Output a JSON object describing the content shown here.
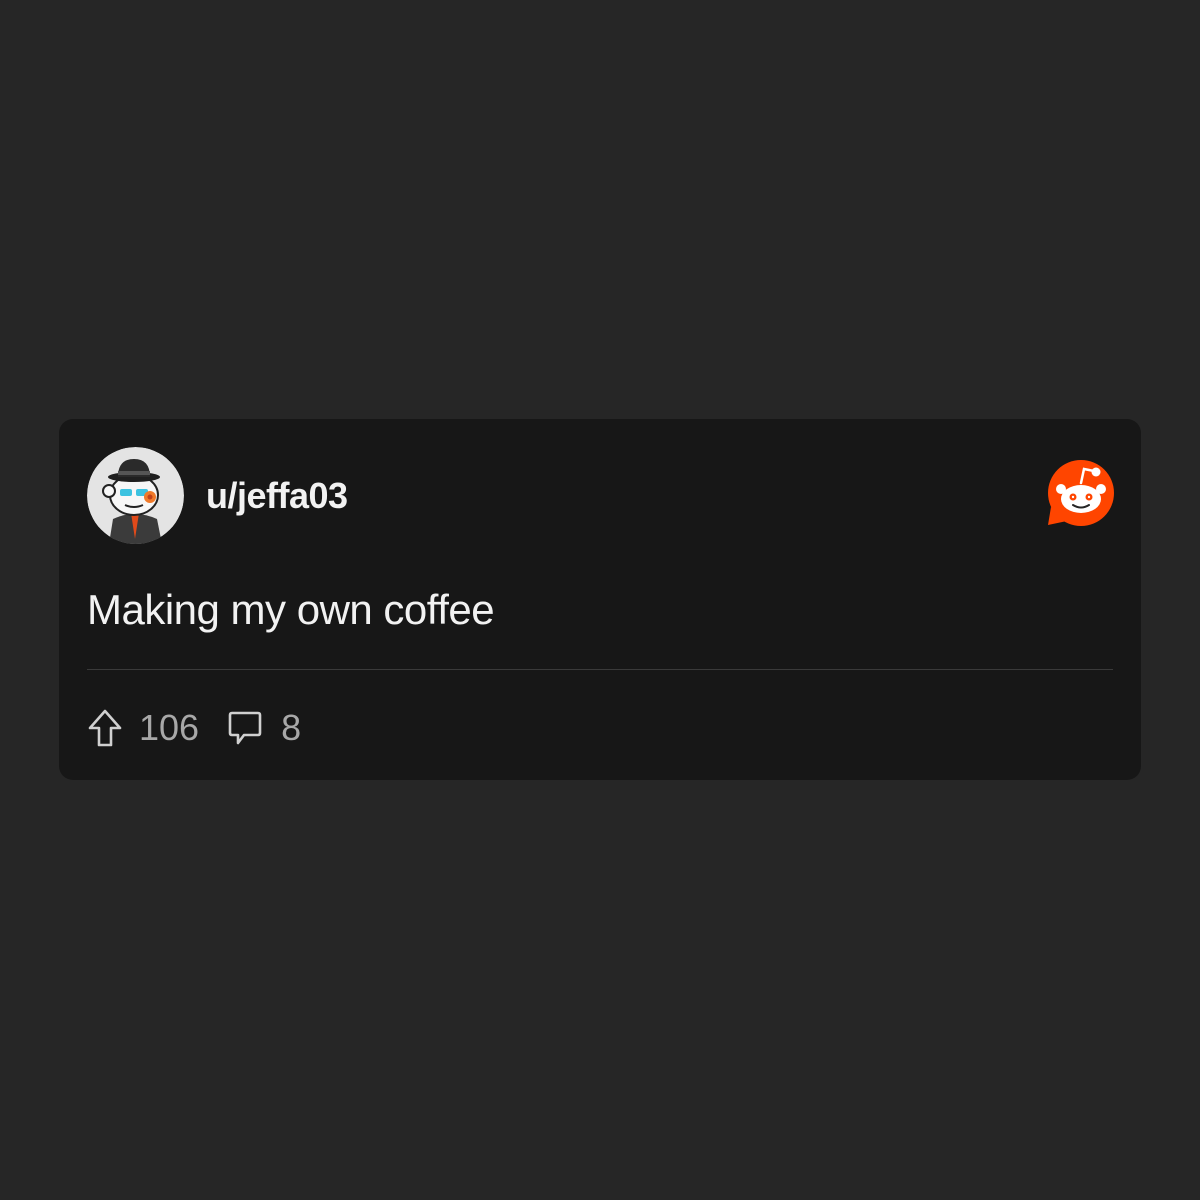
{
  "post": {
    "username": "u/jeffa03",
    "text": "Making my own coffee",
    "upvotes": "106",
    "comments": "8"
  },
  "icons": {
    "avatar": "snoo-avatar-bowler-hat",
    "brand": "reddit-logo",
    "upvote": "upvote-arrow-icon",
    "comment": "speech-bubble-icon"
  },
  "colors": {
    "page_background": "#262626",
    "card_background": "#171717",
    "brand_orange": "#ff4500",
    "text_primary": "#f2f2f2",
    "text_secondary": "#a8a8a8"
  }
}
